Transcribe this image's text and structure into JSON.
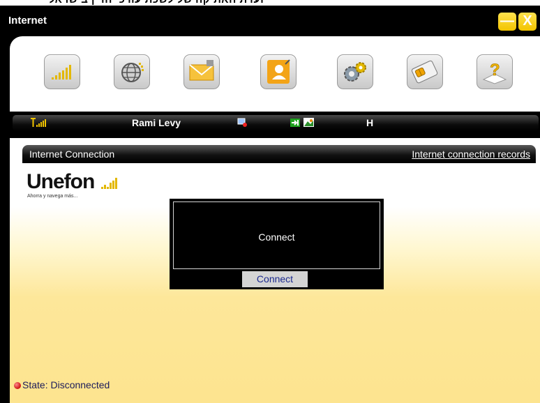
{
  "top_strip_text": "ועדת האתיקה של לשכת עורכי הדין בישראל",
  "window": {
    "title": "Internet",
    "minimize_label": "—",
    "close_label": "X"
  },
  "toolbar": {
    "items": [
      {
        "icon": "signal-bars-icon",
        "label": ""
      },
      {
        "icon": "globe-icon",
        "label": ""
      },
      {
        "icon": "envelope-icon",
        "label": ""
      },
      {
        "icon": "contacts-icon",
        "label": ""
      },
      {
        "icon": "gears-icon",
        "label": ""
      },
      {
        "icon": "sim-card-icon",
        "label": ""
      },
      {
        "icon": "help-icon",
        "label": ""
      }
    ]
  },
  "statusbar": {
    "operator": "Rami Levy",
    "network_type": "H",
    "signal_color": "#f2c400"
  },
  "internet": {
    "section_title": "Internet Connection",
    "records_link": "Internet connection records"
  },
  "logo": {
    "name": "Unefon",
    "tagline": "Ahorra y navega más..."
  },
  "dialog": {
    "message": "Connect",
    "button_label": "Connect"
  },
  "state": {
    "text": "State: Disconnected",
    "color": "#cc1111"
  }
}
